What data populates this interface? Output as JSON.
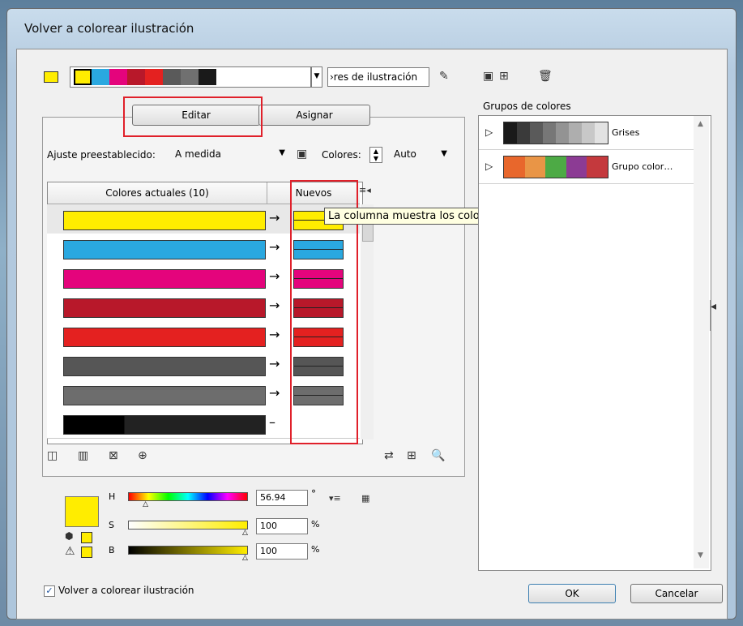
{
  "window": {
    "title": "Volver a colorear ilustración"
  },
  "top_bar": {
    "swatches": [
      "#ffed00",
      "#2aa8e0",
      "#e4047c",
      "#b8182a",
      "#e42120",
      "#5a5a5a",
      "#707070",
      "#1a1a1a"
    ],
    "dropdown_value": "›res de ilustración"
  },
  "tabs": {
    "edit": "Editar",
    "assign": "Asignar"
  },
  "preset": {
    "label": "Ajuste preestablecido:",
    "value": "A medida"
  },
  "colors_field": {
    "label": "Colores:",
    "value": "Auto"
  },
  "table": {
    "header_current": "Colores actuales (10)",
    "header_new": "Nuevos",
    "rows": [
      {
        "current": "#ffed00",
        "new": "#ffed00",
        "selected": true
      },
      {
        "current": "#2aa8e0",
        "new": "#2aa8e0"
      },
      {
        "current": "#e4047c",
        "new": "#e4047c"
      },
      {
        "current": "#b8182a",
        "new": "#b8182a"
      },
      {
        "current": "#e42120",
        "new": "#e42120"
      },
      {
        "current": "#565656",
        "new": "#565656"
      },
      {
        "current": "#6d6d6d",
        "new": "#6d6d6d"
      },
      {
        "current": "#111111",
        "new": ""
      }
    ]
  },
  "tooltip": "La columna muestra los colores del grupo de colores actual",
  "groups": {
    "title": "Grupos de colores",
    "items": [
      {
        "name": "Grises",
        "swatches": [
          "#1a1a1a",
          "#3a3a3a",
          "#5a5a5a",
          "#777777",
          "#939393",
          "#aeaeae",
          "#c8c8c8",
          "#e2e2e2"
        ]
      },
      {
        "name": "Grupo color…",
        "swatches": [
          "#e8672c",
          "#e99546",
          "#4daa45",
          "#8c3b94",
          "#c4393d"
        ]
      }
    ]
  },
  "sliders": {
    "h_label": "H",
    "h_value": "56.94",
    "h_unit": "°",
    "s_label": "S",
    "s_value": "100",
    "s_unit": "%",
    "b_label": "B",
    "b_value": "100",
    "b_unit": "%",
    "h_fraction": 0.158,
    "s_fraction": 1.0,
    "b_fraction": 1.0,
    "preview_color": "#ffed00"
  },
  "checkbox": {
    "label": "Volver a colorear ilustración",
    "checked": true
  },
  "buttons": {
    "ok": "OK",
    "cancel": "Cancelar"
  }
}
